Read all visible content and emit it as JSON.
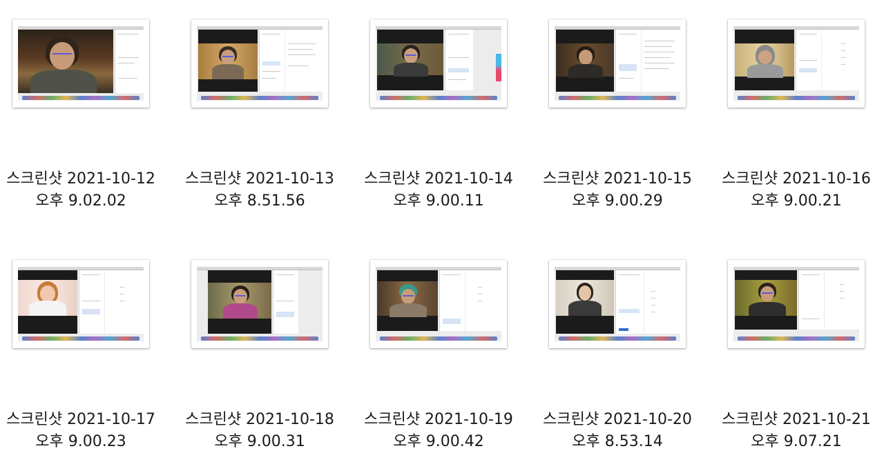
{
  "files": [
    {
      "line1": "스크린샷 2021-10-12",
      "line2": "오후 9.02.02"
    },
    {
      "line1": "스크린샷 2021-10-13",
      "line2": "오후 8.51.56"
    },
    {
      "line1": "스크린샷 2021-10-14",
      "line2": "오후 9.00.11"
    },
    {
      "line1": "스크린샷 2021-10-15",
      "line2": "오후 9.00.29"
    },
    {
      "line1": "스크린샷 2021-10-16",
      "line2": "오후 9.00.21"
    },
    {
      "line1": "스크린샷 2021-10-17",
      "line2": "오후 9.00.23"
    },
    {
      "line1": "스크린샷 2021-10-18",
      "line2": "오후 9.00.31"
    },
    {
      "line1": "스크린샷 2021-10-19",
      "line2": "오후 9.00.42"
    },
    {
      "line1": "스크린샷 2021-10-20",
      "line2": "오후 8.53.14"
    },
    {
      "line1": "스크린샷 2021-10-21",
      "line2": "오후 9.07.21"
    }
  ]
}
